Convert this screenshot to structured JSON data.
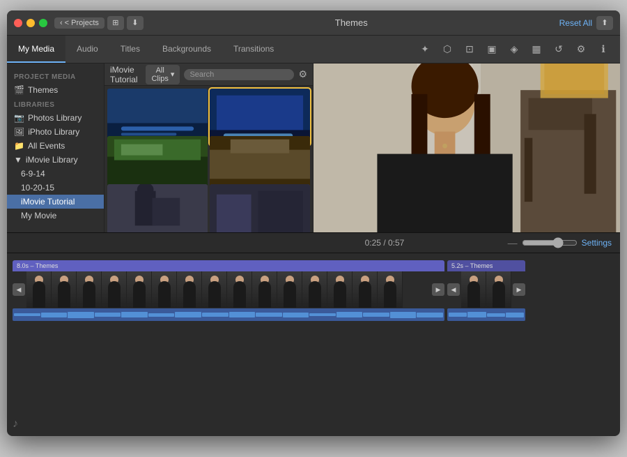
{
  "window": {
    "title": "Themes",
    "traffic_lights": [
      "close",
      "minimize",
      "maximize"
    ]
  },
  "titlebar": {
    "projects_btn": "< Projects",
    "title": "Themes",
    "reset_all_btn": "Reset All"
  },
  "toolbar": {
    "tabs": [
      {
        "label": "My Media",
        "active": true
      },
      {
        "label": "Audio",
        "active": false
      },
      {
        "label": "Titles",
        "active": false
      },
      {
        "label": "Backgrounds",
        "active": false
      },
      {
        "label": "Transitions",
        "active": false
      }
    ],
    "icons": [
      "wand",
      "film",
      "crop",
      "camera",
      "speaker",
      "chart",
      "undo",
      "settings",
      "info"
    ]
  },
  "sidebar": {
    "project_media_label": "PROJECT MEDIA",
    "project_media_items": [
      {
        "label": "Themes",
        "icon": "🎬",
        "active": false
      }
    ],
    "libraries_label": "LIBRARIES",
    "library_items": [
      {
        "label": "Photos Library",
        "icon": "📷",
        "indent": 0
      },
      {
        "label": "iPhoto Library",
        "icon": "🖼",
        "indent": 0
      },
      {
        "label": "All Events",
        "icon": "📁",
        "indent": 0
      },
      {
        "label": "iMovie Library",
        "icon": "▼",
        "indent": 0
      },
      {
        "label": "6-9-14",
        "icon": "",
        "indent": 1
      },
      {
        "label": "10-20-15",
        "icon": "",
        "indent": 1
      },
      {
        "label": "iMovie Tutorial",
        "icon": "",
        "indent": 1,
        "active": true
      },
      {
        "label": "My Movie",
        "icon": "",
        "indent": 1
      }
    ]
  },
  "media_browser": {
    "filter_label": "All Clips",
    "search_placeholder": "Search",
    "thumbnails": [
      {
        "id": 1,
        "type": "blue",
        "has_bar": true,
        "bar_color": "blue"
      },
      {
        "id": 2,
        "type": "blue",
        "has_bar": true,
        "bar_color": "blue",
        "selected": true
      },
      {
        "id": 3,
        "type": "green",
        "has_bar": false
      },
      {
        "id": 4,
        "type": "green",
        "has_bar": false
      },
      {
        "id": 5,
        "type": "gray",
        "has_bar": false
      },
      {
        "id": 6,
        "type": "gray",
        "has_bar": false
      }
    ]
  },
  "timeline": {
    "current_time": "0:25",
    "total_time": "0:57",
    "time_display": "0:25 / 0:57",
    "settings_label": "Settings",
    "clips": [
      {
        "label": "8.0s – Themes",
        "type": "main",
        "frame_count": 17
      },
      {
        "label": "5.2s – Themes",
        "type": "right",
        "frame_count": 3
      }
    ]
  },
  "icons": {
    "wand": "✦",
    "film": "⬡",
    "crop": "⊡",
    "camera": "▣",
    "speaker": "◈",
    "chart": "▦",
    "undo": "↺",
    "settings": "⚙",
    "info": "ℹ",
    "search": "🔍",
    "gear": "⚙"
  },
  "colors": {
    "accent": "#6eb3f7",
    "active_sidebar": "#4a6fa5",
    "clip_bar": "#6060c0",
    "timeline_bg": "#232323",
    "toolbar_bg": "#3a3a3a"
  }
}
